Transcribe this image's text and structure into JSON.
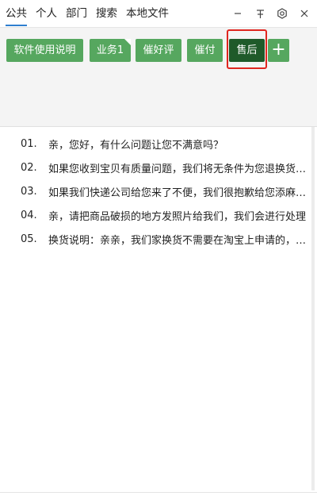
{
  "tabs": [
    {
      "label": "公共",
      "active": true
    },
    {
      "label": "个人"
    },
    {
      "label": "部门"
    },
    {
      "label": "搜索"
    },
    {
      "label": "本地文件"
    }
  ],
  "window_controls": {
    "minimize": "−",
    "pin": "平",
    "settings": "settings-icon",
    "close": "×"
  },
  "toolbar": {
    "buttons": [
      {
        "label": "软件使用说明"
      },
      {
        "label": "业务1"
      },
      {
        "label": "催好评"
      },
      {
        "label": "催付"
      },
      {
        "label": "售后",
        "selected": true
      },
      {
        "label": "+"
      }
    ]
  },
  "phrases": [
    {
      "num": "01.",
      "text": "亲，您好，有什么问题让您不满意吗？"
    },
    {
      "num": "02.",
      "text": "如果您收到宝贝有质量问题，我们将无条件为您退换货，并承担来回运费"
    },
    {
      "num": "03.",
      "text": "如果我们快递公司给您来了不便，我们很抱歉给您添麻烦了"
    },
    {
      "num": "04.",
      "text": "亲，请把商品破损的地方发照片给我们，我们会进行处理"
    },
    {
      "num": "05.",
      "text": "换货说明：亲亲，我们家换货不需要在淘宝上申请的，直接寄回即可"
    }
  ],
  "colors": {
    "button_green": "#56a75f",
    "selected_dark_green": "#1f5a2a",
    "highlight_red": "#e0261f",
    "tab_underline": "#2f7fcf"
  }
}
